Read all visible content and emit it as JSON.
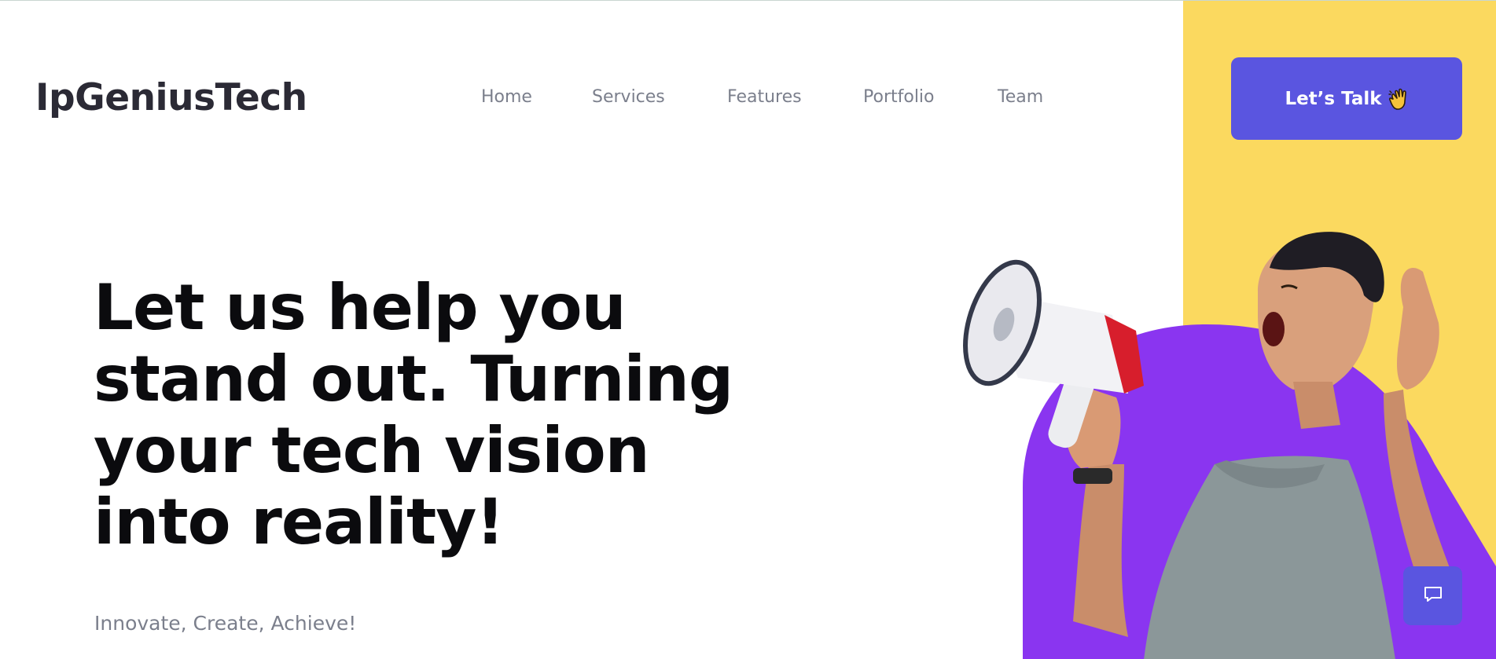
{
  "header": {
    "logo": "IpGeniusTech",
    "nav": [
      {
        "label": "Home"
      },
      {
        "label": "Services"
      },
      {
        "label": "Features"
      },
      {
        "label": "Portfolio"
      },
      {
        "label": "Team"
      }
    ],
    "cta_label": "Let’s Talk",
    "cta_icon": "waving-hand-icon"
  },
  "hero": {
    "title_part1": "Let us ",
    "title_highlight": "help",
    "title_part2": " you stand out. Turning your tech vision into reality!",
    "subtitle": "Innovate, Create, Achieve!"
  },
  "colors": {
    "accent_yellow": "#fbd95f",
    "brand_purple": "#5a55e0",
    "circle_purple": "#8a35f0",
    "text_dark": "#0b0b0e",
    "text_muted": "#7b7f8c"
  },
  "chat_widget": {
    "icon": "chat-bubble-icon"
  }
}
